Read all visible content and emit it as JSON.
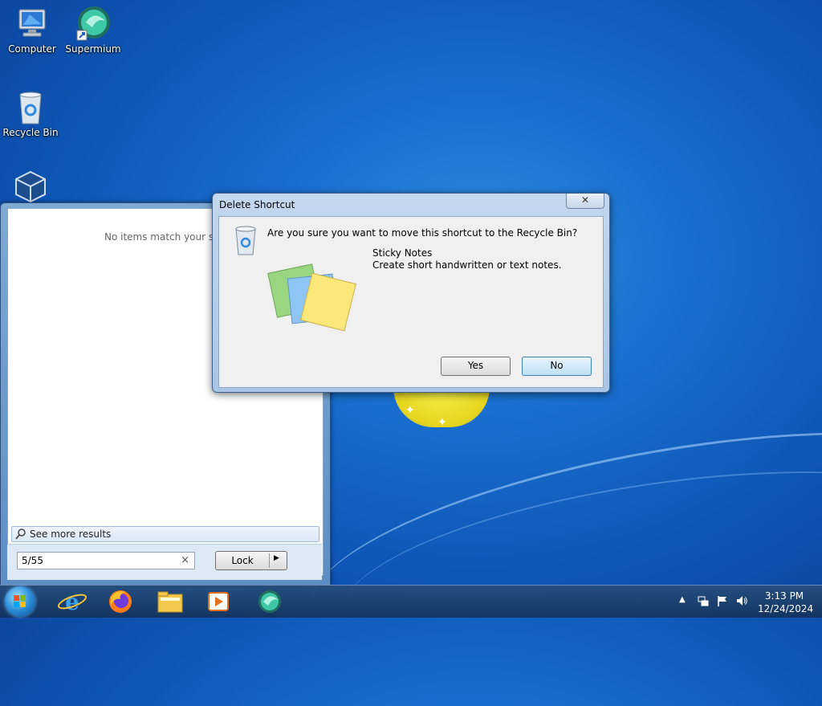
{
  "desktop": {
    "icons": [
      {
        "label": "Computer"
      },
      {
        "label": "Supermium"
      },
      {
        "label": "Recycle Bin"
      },
      {
        "label": ""
      }
    ]
  },
  "start_menu": {
    "no_items_text": "No items match your search.",
    "see_more_label": "See more results",
    "search_value": "5/55",
    "lock_label": "Lock"
  },
  "dialog": {
    "title": "Delete Shortcut",
    "close_glyph": "✕",
    "question": "Are you sure you want to move this shortcut to the Recycle Bin?",
    "item_name": "Sticky Notes",
    "item_description": "Create short handwritten or text notes.",
    "yes_label": "Yes",
    "no_label": "No"
  },
  "taskbar": {
    "apps": [
      "internet-explorer-icon",
      "firefox-icon",
      "file-explorer-icon",
      "media-player-icon",
      "supermium-icon"
    ],
    "time": "3:13 PM",
    "date": "12/24/2024"
  }
}
